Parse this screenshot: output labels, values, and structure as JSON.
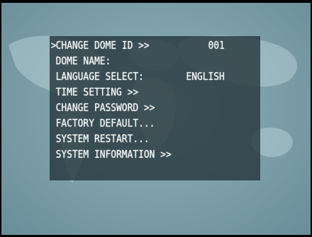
{
  "colors": {
    "panel": "#223238",
    "text": "#f2f4f2",
    "background": "#7b9ea8"
  },
  "menu": {
    "cursor": ">",
    "items": [
      {
        "label": "CHANGE DOME ID >>",
        "value": "001"
      },
      {
        "label": "DOME NAME:",
        "value": ""
      },
      {
        "label": "LANGUAGE SELECT:",
        "value": "ENGLISH"
      },
      {
        "label": "TIME SETTING >>",
        "value": ""
      },
      {
        "label": "CHANGE PASSWORD >>",
        "value": ""
      },
      {
        "label": "FACTORY DEFAULT...",
        "value": ""
      },
      {
        "label": "SYSTEM RESTART...",
        "value": ""
      },
      {
        "label": "SYSTEM INFORMATION >>",
        "value": ""
      }
    ]
  }
}
